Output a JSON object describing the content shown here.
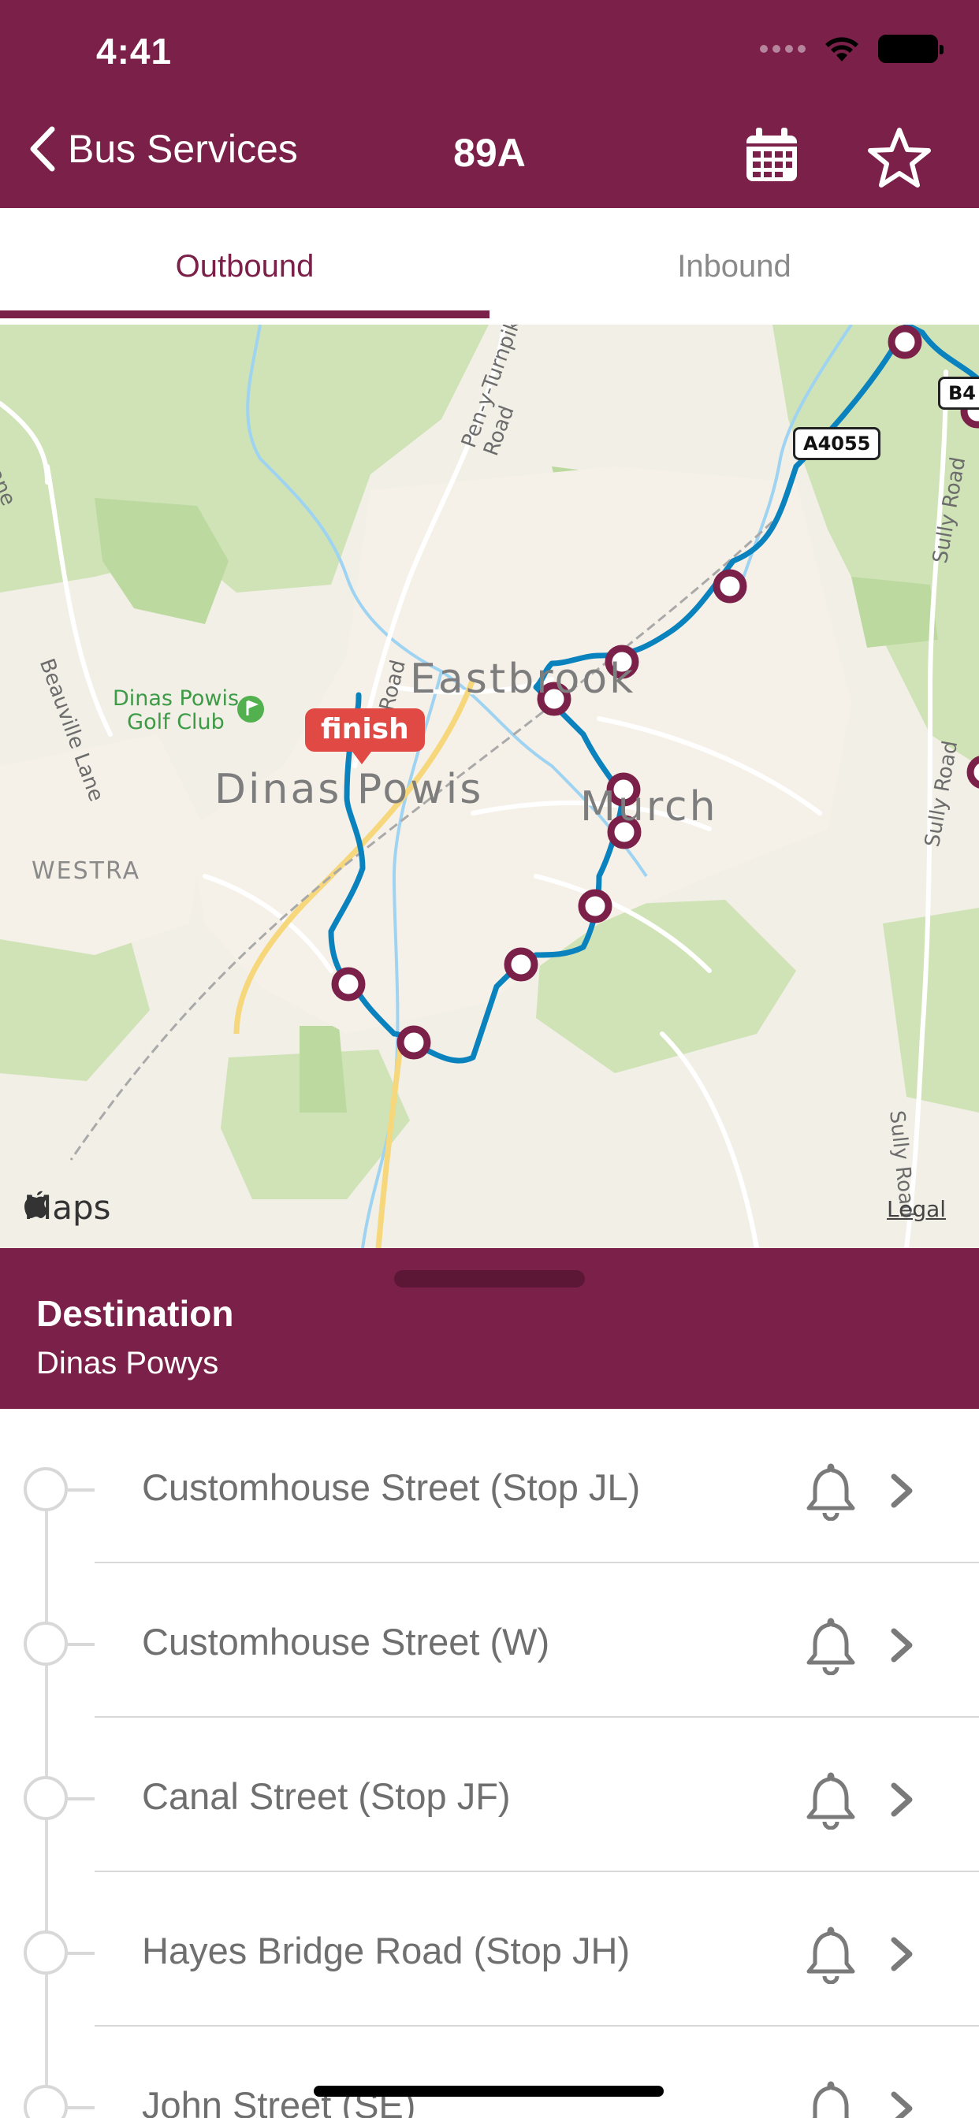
{
  "status_bar": {
    "time": "4:41"
  },
  "nav": {
    "back_label": "Bus Services",
    "title": "89A"
  },
  "tabs": [
    {
      "label": "Outbound",
      "active": true
    },
    {
      "label": "Inbound",
      "active": false
    }
  ],
  "map": {
    "town_labels": [
      "Eastbrook",
      "Dinas Powis",
      "Murch",
      "WESTRA"
    ],
    "road_labels": [
      "Beauville Lane",
      "Pen-y-Turnpike Road",
      "Sully Road",
      "Sully Road",
      "Sully Road",
      "Road",
      "ane"
    ],
    "road_shields": [
      "A4055",
      "B4"
    ],
    "golf_label": "Dinas Powis Golf Club",
    "finish_label": "finish",
    "maps_logo": "Maps",
    "legal_link": "Legal",
    "colors": {
      "route": "#0a82be",
      "stop_marker": "#7b2149",
      "finish": "#e14a44"
    }
  },
  "destination": {
    "heading": "Destination",
    "name": "Dinas Powys"
  },
  "stops": [
    {
      "name": "Customhouse Street (Stop JL)"
    },
    {
      "name": "Customhouse Street (W)"
    },
    {
      "name": "Canal Street (Stop JF)"
    },
    {
      "name": "Hayes Bridge Road (Stop JH)"
    },
    {
      "name": "John Street (SE)"
    }
  ],
  "theme": {
    "brand": "#7b2149"
  }
}
